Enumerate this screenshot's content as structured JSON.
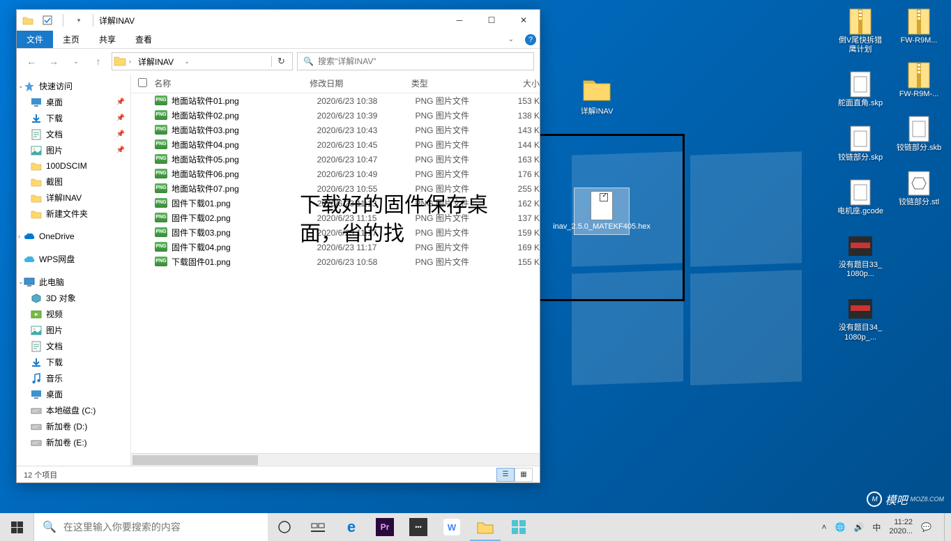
{
  "window": {
    "title": "详解INAV",
    "ribbon": {
      "file": "文件",
      "home": "主页",
      "share": "共享",
      "view": "查看"
    },
    "breadcrumb": "详解INAV",
    "search_placeholder": "搜索\"详解INAV\"",
    "columns": {
      "name": "名称",
      "date": "修改日期",
      "type": "类型",
      "size": "大小"
    },
    "status": "12 个项目"
  },
  "sidebar": {
    "quick": "快速访问",
    "quick_items": [
      {
        "label": "桌面",
        "pin": true,
        "icon": "desktop"
      },
      {
        "label": "下载",
        "pin": true,
        "icon": "download"
      },
      {
        "label": "文档",
        "pin": true,
        "icon": "document"
      },
      {
        "label": "图片",
        "pin": true,
        "icon": "pictures"
      },
      {
        "label": "100DSCIM",
        "pin": false,
        "icon": "folder"
      },
      {
        "label": "截图",
        "pin": false,
        "icon": "folder"
      },
      {
        "label": "详解INAV",
        "pin": false,
        "icon": "folder"
      },
      {
        "label": "新建文件夹",
        "pin": false,
        "icon": "folder"
      }
    ],
    "onedrive": "OneDrive",
    "wps": "WPS网盘",
    "thispc": "此电脑",
    "pc_items": [
      {
        "label": "3D 对象",
        "icon": "3d"
      },
      {
        "label": "视频",
        "icon": "video"
      },
      {
        "label": "图片",
        "icon": "pictures"
      },
      {
        "label": "文档",
        "icon": "document"
      },
      {
        "label": "下载",
        "icon": "download"
      },
      {
        "label": "音乐",
        "icon": "music"
      },
      {
        "label": "桌面",
        "icon": "desktop"
      },
      {
        "label": "本地磁盘 (C:)",
        "icon": "drive"
      },
      {
        "label": "新加卷 (D:)",
        "icon": "drive"
      },
      {
        "label": "新加卷 (E:)",
        "icon": "drive"
      }
    ]
  },
  "files": [
    {
      "name": "地面站软件01.png",
      "date": "2020/6/23 10:38",
      "type": "PNG 图片文件",
      "size": "153 K"
    },
    {
      "name": "地面站软件02.png",
      "date": "2020/6/23 10:39",
      "type": "PNG 图片文件",
      "size": "138 K"
    },
    {
      "name": "地面站软件03.png",
      "date": "2020/6/23 10:43",
      "type": "PNG 图片文件",
      "size": "143 K"
    },
    {
      "name": "地面站软件04.png",
      "date": "2020/6/23 10:45",
      "type": "PNG 图片文件",
      "size": "144 K"
    },
    {
      "name": "地面站软件05.png",
      "date": "2020/6/23 10:47",
      "type": "PNG 图片文件",
      "size": "163 K"
    },
    {
      "name": "地面站软件06.png",
      "date": "2020/6/23 10:49",
      "type": "PNG 图片文件",
      "size": "176 K"
    },
    {
      "name": "地面站软件07.png",
      "date": "2020/6/23 10:55",
      "type": "PNG 图片文件",
      "size": "255 K"
    },
    {
      "name": "固件下载01.png",
      "date": "2020/6/23 11:13",
      "type": "PNG 图片文件",
      "size": "162 K"
    },
    {
      "name": "固件下载02.png",
      "date": "2020/6/23 11:15",
      "type": "PNG 图片文件",
      "size": "137 K"
    },
    {
      "name": "固件下载03.png",
      "date": "2020/6/23 11:17",
      "type": "PNG 图片文件",
      "size": "159 K"
    },
    {
      "name": "固件下载04.png",
      "date": "2020/6/23 11:17",
      "type": "PNG 图片文件",
      "size": "169 K"
    },
    {
      "name": "下载固件01.png",
      "date": "2020/6/23 10:58",
      "type": "PNG 图片文件",
      "size": "155 K"
    }
  ],
  "desktop": {
    "inav_folder": "详解INAV",
    "hex_file": "inav_2.5.0_MATEKF405.hex",
    "col1": [
      {
        "label": "倒V尾快拆猎鹰计划"
      },
      {
        "label": "舵面直角.skp"
      },
      {
        "label": "铰链部分.skp"
      },
      {
        "label": "电机座.gcode"
      },
      {
        "label": "没有题目33_1080p..."
      },
      {
        "label": "没有题目34_1080p_..."
      }
    ],
    "col2": [
      {
        "label": "FW-R9M..."
      },
      {
        "label": "FW-R9M-..."
      },
      {
        "label": "铰链部分.skb"
      },
      {
        "label": "铰链部分.stl"
      }
    ]
  },
  "annotation": "下载好的固件保存桌\n面，省的找",
  "taskbar": {
    "search_placeholder": "在这里输入你要搜索的内容",
    "ime": "中",
    "time": "11:22",
    "date": "2020..."
  },
  "watermark": "模吧"
}
